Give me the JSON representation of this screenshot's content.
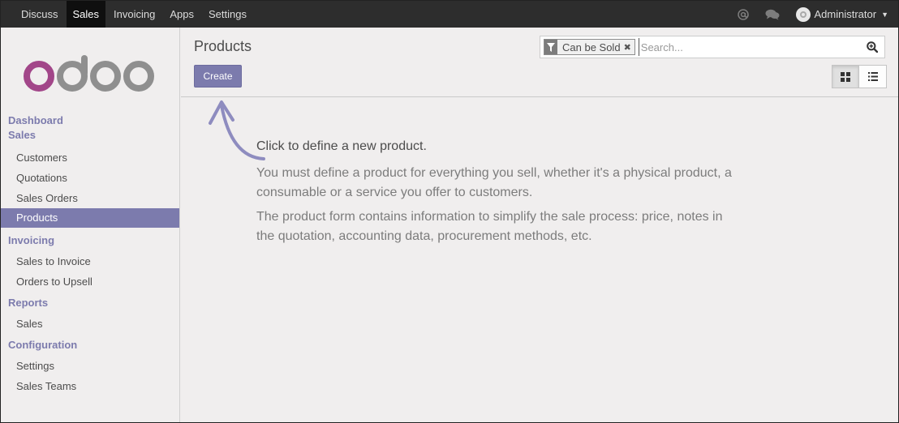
{
  "topbar": {
    "menu": [
      {
        "label": "Discuss",
        "active": false
      },
      {
        "label": "Sales",
        "active": true
      },
      {
        "label": "Invoicing",
        "active": false
      },
      {
        "label": "Apps",
        "active": false
      },
      {
        "label": "Settings",
        "active": false
      }
    ],
    "icons": [
      "at-icon",
      "chat-icon"
    ],
    "user_name": "Administrator"
  },
  "logo_text": "odoo",
  "sidebar": {
    "sections": [
      {
        "title": "Dashboard",
        "items": []
      },
      {
        "title": "Sales",
        "items": [
          {
            "label": "Customers",
            "active": false
          },
          {
            "label": "Quotations",
            "active": false
          },
          {
            "label": "Sales Orders",
            "active": false
          },
          {
            "label": "Products",
            "active": true
          }
        ]
      },
      {
        "title": "Invoicing",
        "items": [
          {
            "label": "Sales to Invoice",
            "active": false
          },
          {
            "label": "Orders to Upsell",
            "active": false
          }
        ]
      },
      {
        "title": "Reports",
        "items": [
          {
            "label": "Sales",
            "active": false
          }
        ]
      },
      {
        "title": "Configuration",
        "items": [
          {
            "label": "Settings",
            "active": false
          },
          {
            "label": "Sales Teams",
            "active": false
          }
        ]
      }
    ]
  },
  "control_panel": {
    "breadcrumb": "Products",
    "create_label": "Create",
    "search": {
      "facet_label": "Can be Sold",
      "placeholder": "Search..."
    },
    "views": [
      {
        "name": "kanban",
        "active": true
      },
      {
        "name": "list",
        "active": false
      }
    ]
  },
  "helper": {
    "title": "Click to define a new product.",
    "paragraphs": [
      "You must define a product for everything you sell, whether it's a physical product, a consumable or a service you offer to customers.",
      "The product form contains information to simplify the sale process: price, notes in the quotation, accounting data, procurement methods, etc."
    ]
  },
  "colors": {
    "accent": "#7c7bad",
    "topbar": "#2d2d2d",
    "background": "#f0eeee"
  }
}
